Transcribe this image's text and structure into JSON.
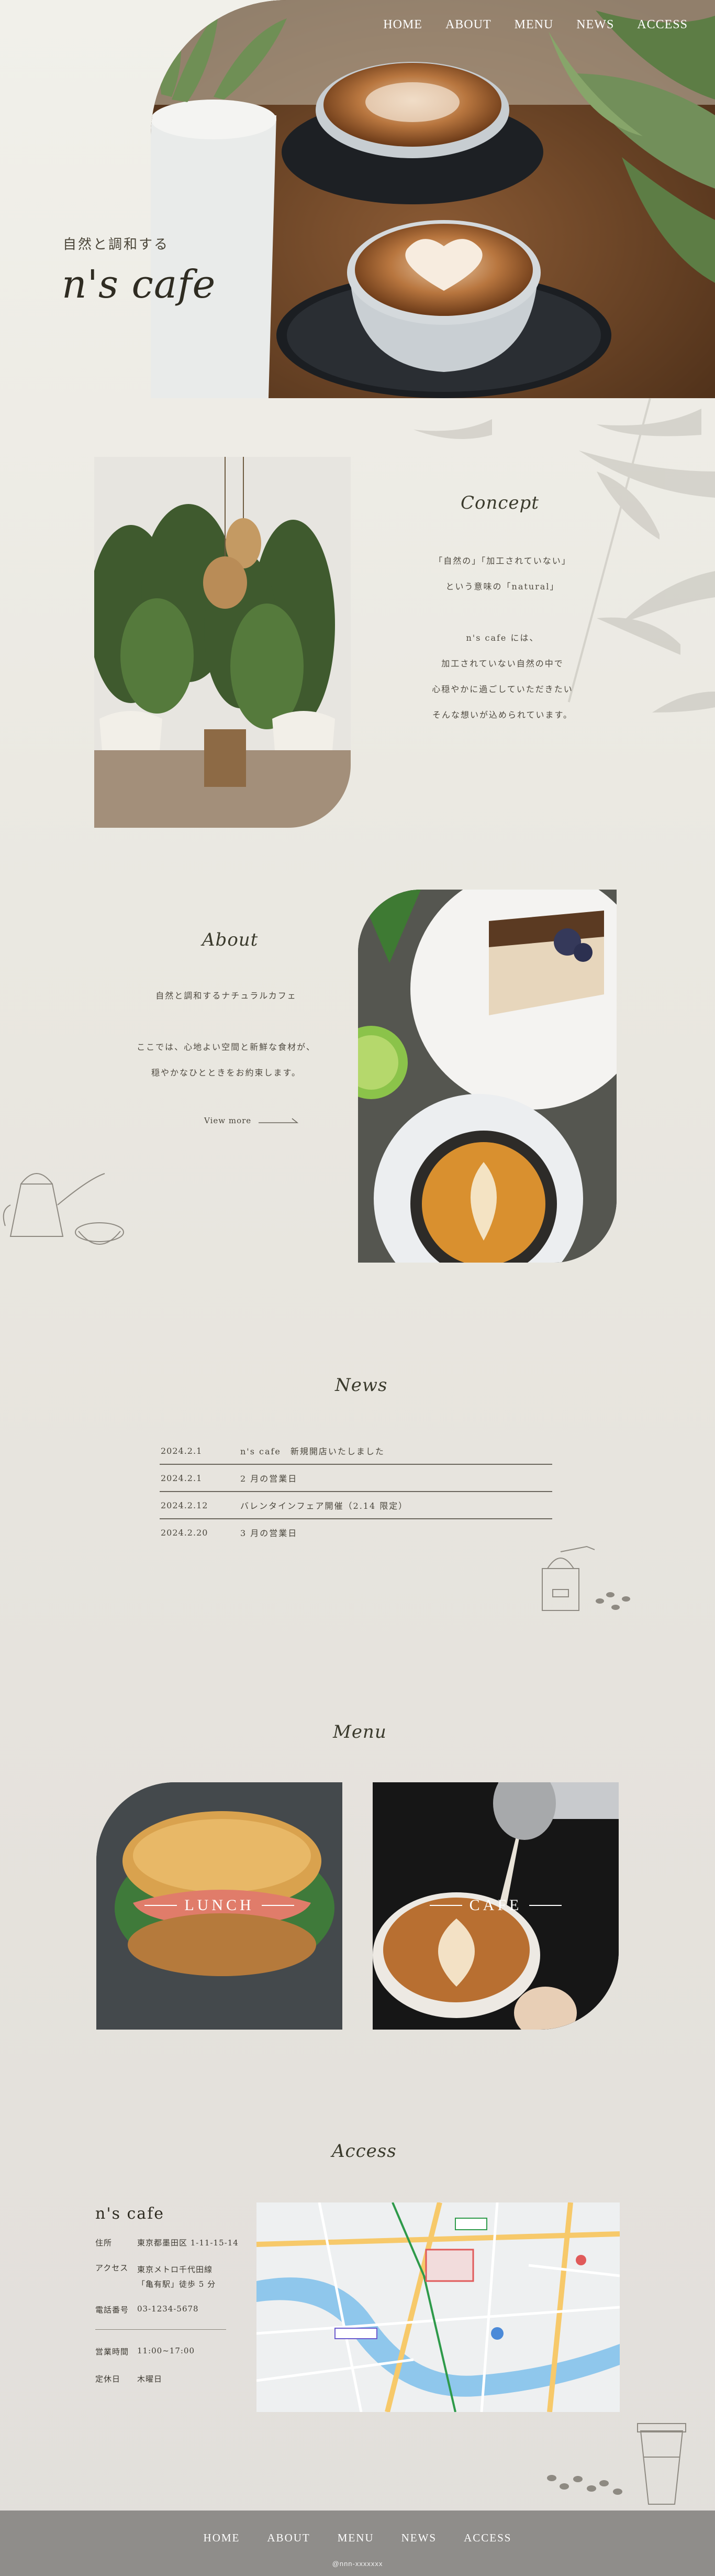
{
  "nav": [
    "HOME",
    "ABOUT",
    "MENU",
    "NEWS",
    "ACCESS"
  ],
  "hero": {
    "subtitle": "自然と調和する",
    "title": "n's cafe"
  },
  "concept": {
    "title": "Concept",
    "lines": [
      "「自然の」「加工されていない」",
      "という意味の「natural」",
      "",
      "n's cafe には、",
      "加工されていない自然の中で",
      "心穏やかに過ごしていただきたい",
      "そんな想いが込められています。"
    ]
  },
  "about": {
    "title": "About",
    "lines": [
      "自然と調和するナチュラルカフェ",
      "",
      "ここでは、心地よい空間と新鮮な食材が、",
      "穏やかなひとときをお約束します。"
    ],
    "view_more": "View more"
  },
  "news": {
    "title": "News",
    "items": [
      {
        "date": "2024.2.1",
        "text": "n's cafe　新規開店いたしました"
      },
      {
        "date": "2024.2.1",
        "text": "2 月の営業日"
      },
      {
        "date": "2024.2.12",
        "text": "バレンタインフェア開催（2.14 限定）"
      },
      {
        "date": "2024.2.20",
        "text": "3 月の営業日"
      }
    ]
  },
  "menu": {
    "title": "Menu",
    "lunch": "LUNCH",
    "cafe": "CAFE"
  },
  "access": {
    "title": "Access",
    "name": "n's cafe",
    "address_label": "住所",
    "address": "東京都墨田区 1-11-15-14",
    "route_label": "アクセス",
    "route_1": "東京メトロ千代田線",
    "route_2": "「亀有駅」徒歩 5 分",
    "tel_label": "電話番号",
    "tel": "03-1234-5678",
    "hours_label": "営業時間",
    "hours": "11:00~17:00",
    "closed_label": "定休日",
    "closed": "木曜日"
  },
  "footer": {
    "nav": [
      "HOME",
      "ABOUT",
      "MENU",
      "NEWS",
      "ACCESS"
    ],
    "copyright": "@nnn-xxxxxxx"
  },
  "colors": {
    "footer_bg": "#8f8d8a",
    "page_bg": "#e8e5df",
    "accent_text": "#3a3a2c"
  }
}
